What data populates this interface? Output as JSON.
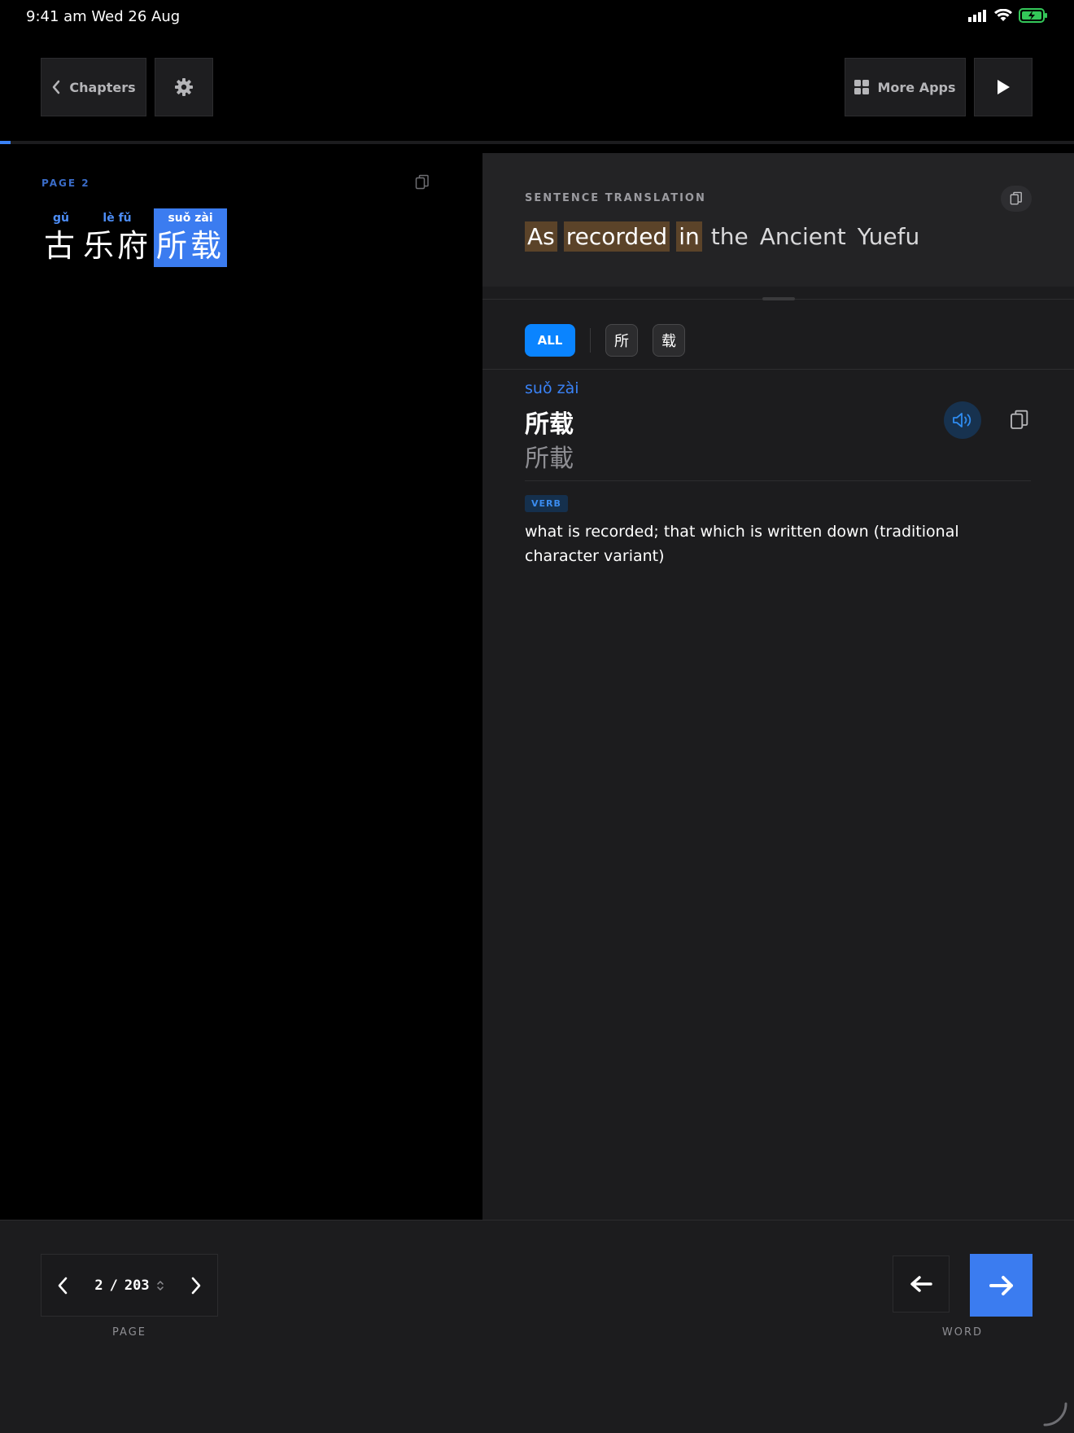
{
  "status_bar": {
    "time_date": "9:41 am   Wed 26 Aug"
  },
  "toolbar": {
    "chapters_label": "Chapters",
    "more_apps_label": "More Apps"
  },
  "reading_progress": 0.01,
  "reader": {
    "page_label": "PAGE  2",
    "words": [
      {
        "pinyin": "gǔ",
        "chars": "古",
        "selected": false
      },
      {
        "pinyin": "lè fǔ",
        "chars": "乐府",
        "selected": false
      },
      {
        "pinyin": "suǒ zài",
        "chars": "所载",
        "selected": true
      }
    ]
  },
  "translation": {
    "label": "SENTENCE TRANSLATION",
    "words": [
      {
        "text": "As",
        "highlighted": true
      },
      {
        "text": "recorded",
        "highlighted": true
      },
      {
        "text": "in",
        "highlighted": true
      },
      {
        "text": "the",
        "highlighted": false
      },
      {
        "text": "Ancient",
        "highlighted": false
      },
      {
        "text": "Yuefu",
        "highlighted": false
      }
    ]
  },
  "filters": {
    "all_label": "ALL",
    "chars": [
      "所",
      "载"
    ]
  },
  "entry": {
    "pinyin": "suǒ zài",
    "simplified": "所载",
    "traditional": "所載",
    "pos": "VERB",
    "definition": "what is recorded; that which is written down (traditional character variant)"
  },
  "pager": {
    "current": "2",
    "separator": "/",
    "total": "203",
    "caption": "PAGE"
  },
  "word_nav": {
    "caption": "WORD"
  },
  "colors": {
    "accent": "#3b7cf0",
    "highlight": "#5b4329",
    "battery": "#34c759"
  }
}
